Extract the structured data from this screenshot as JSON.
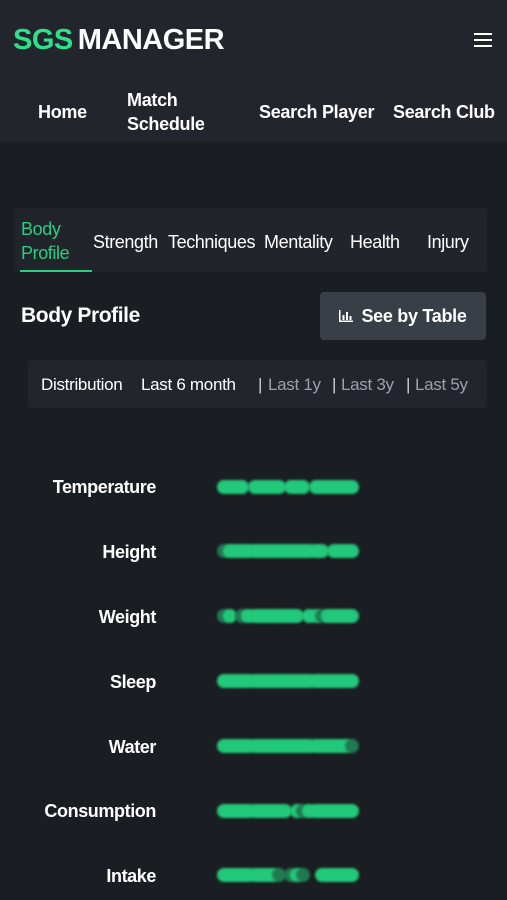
{
  "brand": {
    "part1": "SGS",
    "part2": "MANAGER"
  },
  "menu_icon": "hamburger-icon",
  "nav": {
    "home": "Home",
    "match_schedule": "Match Schedule",
    "search_player": "Search Player",
    "search_club": "Search Club"
  },
  "subtabs": {
    "body_profile": "Body Profile",
    "strength": "Strength",
    "techniques": "Techniques",
    "mentality": "Mentality",
    "health": "Health",
    "injury": "Injury",
    "active": "body_profile"
  },
  "section": {
    "title": "Body Profile",
    "table_button": "See by Table",
    "table_icon": "bar-chart-icon"
  },
  "filters": {
    "distribution": "Distribution",
    "last_6_month": "Last 6 month",
    "last_1y": "Last 1y",
    "last_3y": "Last 3y",
    "last_5y": "Last 5y",
    "separator": "|",
    "selected": "last_6_month"
  },
  "metrics": [
    {
      "label": "Temperature"
    },
    {
      "label": "Height"
    },
    {
      "label": "Weight"
    },
    {
      "label": "Sleep"
    },
    {
      "label": "Water"
    },
    {
      "label": "Consumption"
    },
    {
      "label": "Intake"
    }
  ],
  "colors": {
    "accent": "#2ecc82",
    "brand_green": "#2ee08c",
    "dot_bright": "#23c97a",
    "dot_dim": "#1f7a52",
    "background": "#1a1d21"
  }
}
